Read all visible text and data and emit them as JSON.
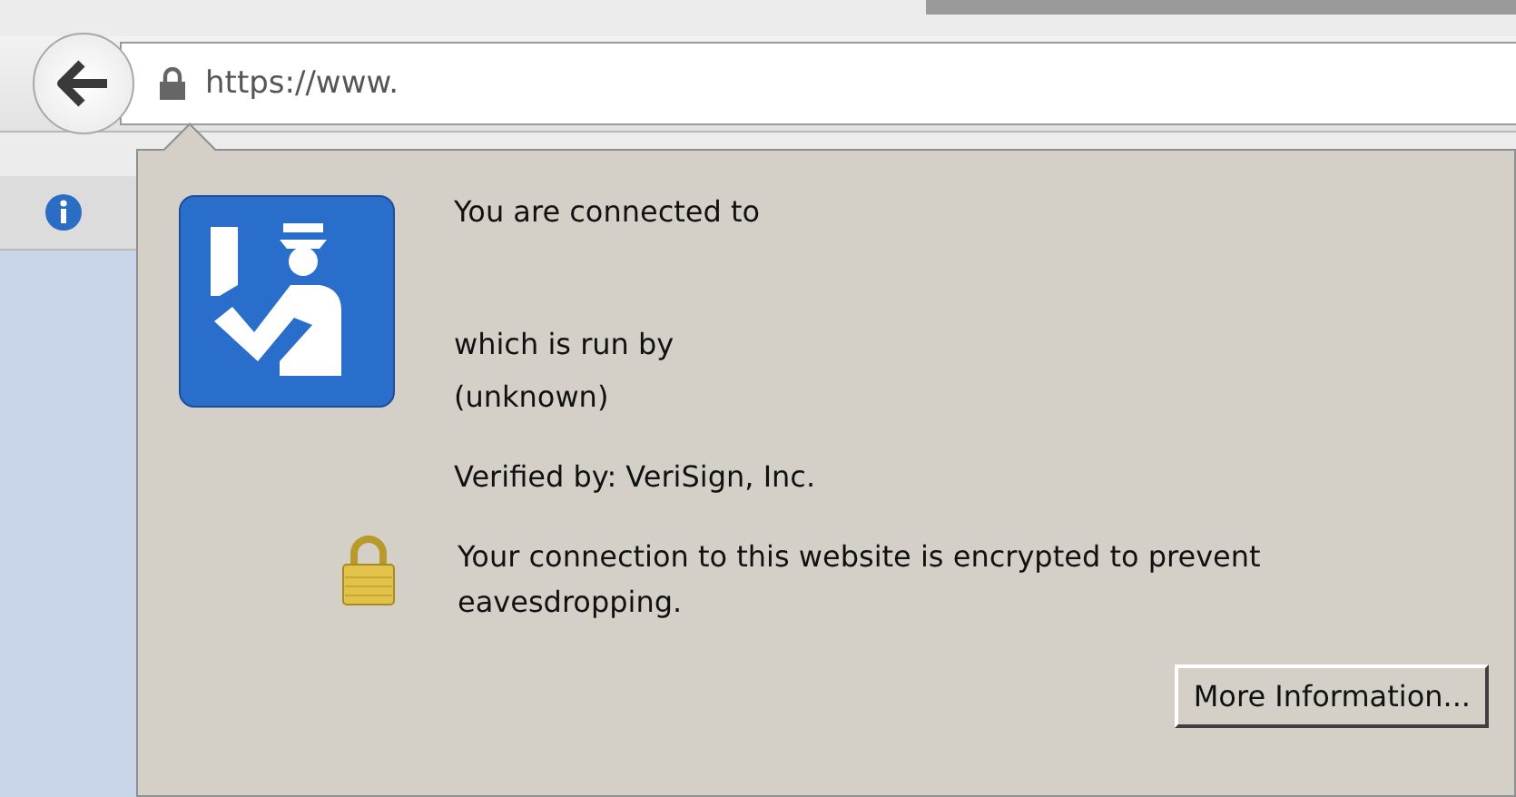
{
  "address_bar": {
    "url": "https://www."
  },
  "identity_popup": {
    "connected_label": "You are connected to",
    "run_by_label": "which is run by",
    "owner": "(unknown)",
    "verified_by": "Verified by: VeriSign, Inc.",
    "encryption_message": "Your connection to this website is encrypted to prevent eavesdropping.",
    "button": "More Information..."
  }
}
